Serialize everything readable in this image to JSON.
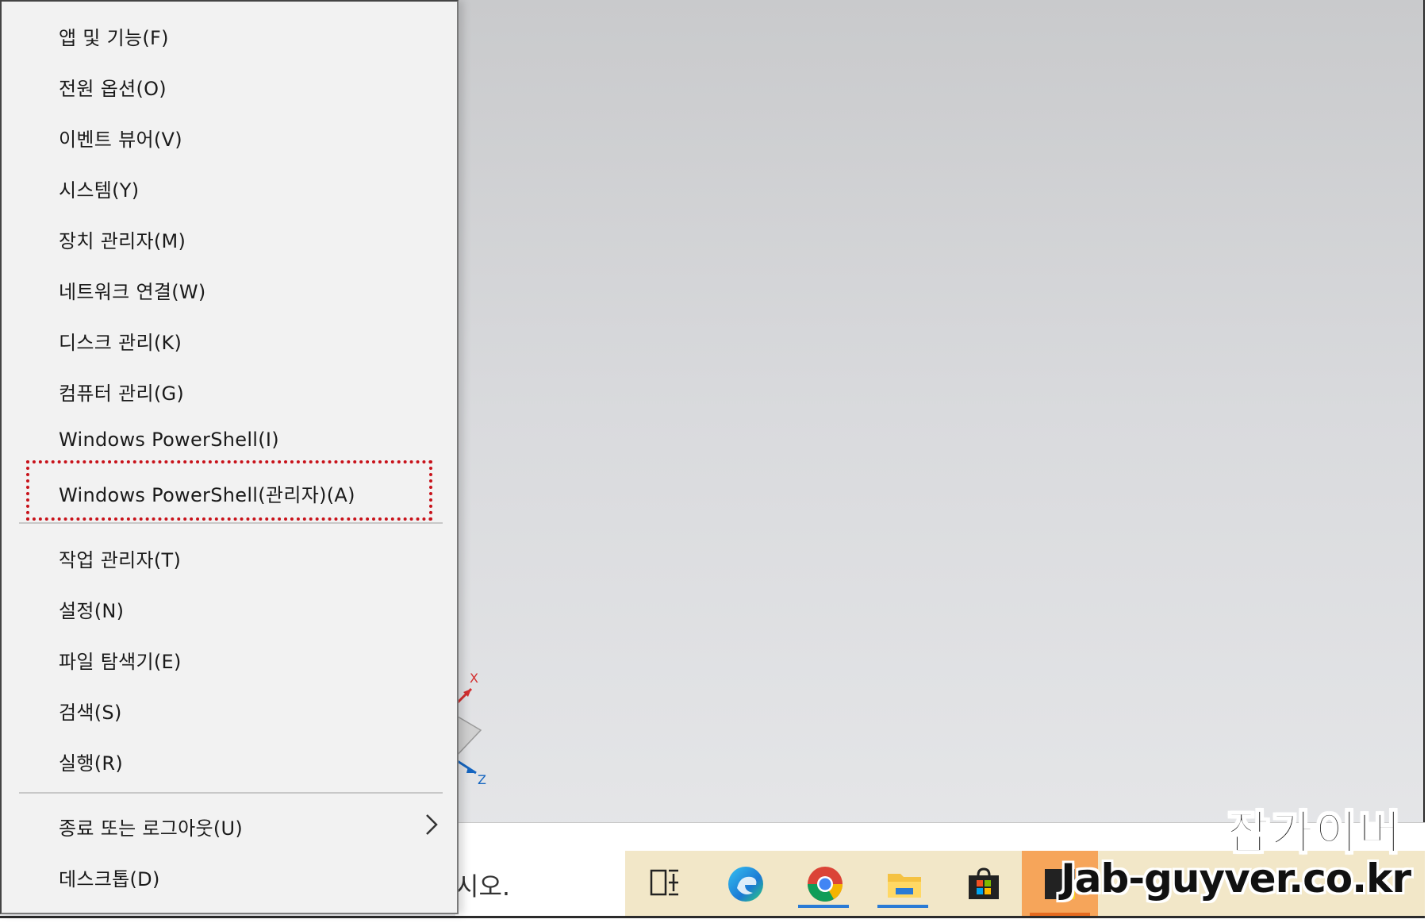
{
  "menu": {
    "items_group1": [
      {
        "label": "앱 및 기능(F)"
      },
      {
        "label": "전원 옵션(O)"
      },
      {
        "label": "이벤트 뷰어(V)"
      },
      {
        "label": "시스템(Y)"
      },
      {
        "label": "장치 관리자(M)"
      },
      {
        "label": "네트워크 연결(W)"
      },
      {
        "label": "디스크 관리(K)"
      },
      {
        "label": "컴퓨터 관리(G)"
      },
      {
        "label": "Windows PowerShell(I)"
      },
      {
        "label": "Windows PowerShell(관리자)(A)"
      }
    ],
    "items_group2": [
      {
        "label": "작업 관리자(T)"
      },
      {
        "label": "설정(N)"
      },
      {
        "label": "파일 탐색기(E)"
      },
      {
        "label": "검색(S)"
      },
      {
        "label": "실행(R)"
      }
    ],
    "items_group3": [
      {
        "label": "종료 또는 로그아웃(U)",
        "has_submenu": true
      },
      {
        "label": "데스크톱(D)"
      }
    ],
    "highlighted_item": "Windows PowerShell(관리자)(A)",
    "highlight_color": "#c8121a"
  },
  "taskbar": {
    "search_text_fragment": "시오.",
    "icons": [
      "task-view-icon",
      "edge-icon",
      "chrome-icon",
      "file-explorer-icon",
      "store-icon",
      "sticky-notes-icon"
    ]
  },
  "axis_gizmo": {
    "x_label": "X",
    "z_label": "Z"
  },
  "watermark": {
    "korean": "잡가이버",
    "url": "Jab-guyver.co.kr"
  }
}
